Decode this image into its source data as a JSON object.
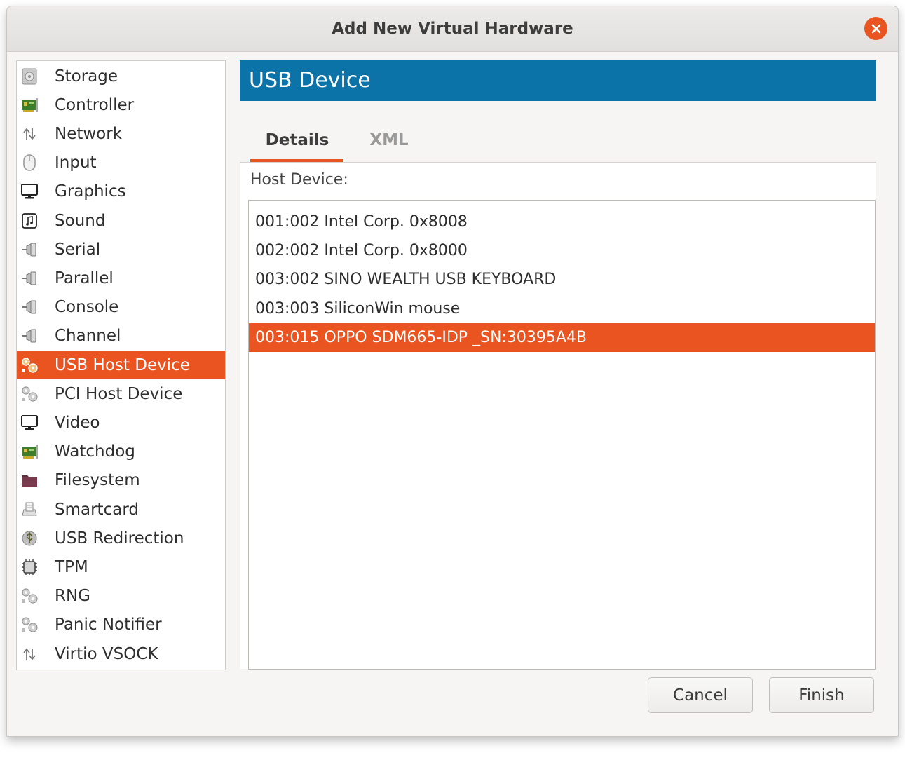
{
  "window": {
    "title": "Add New Virtual Hardware"
  },
  "sidebar": {
    "items": [
      {
        "label": "Storage",
        "icon": "storage-icon"
      },
      {
        "label": "Controller",
        "icon": "controller-icon"
      },
      {
        "label": "Network",
        "icon": "network-icon"
      },
      {
        "label": "Input",
        "icon": "input-icon"
      },
      {
        "label": "Graphics",
        "icon": "graphics-icon"
      },
      {
        "label": "Sound",
        "icon": "sound-icon"
      },
      {
        "label": "Serial",
        "icon": "serial-icon"
      },
      {
        "label": "Parallel",
        "icon": "parallel-icon"
      },
      {
        "label": "Console",
        "icon": "console-icon"
      },
      {
        "label": "Channel",
        "icon": "channel-icon"
      },
      {
        "label": "USB Host Device",
        "icon": "usb-host-device-icon",
        "selected": true
      },
      {
        "label": "PCI Host Device",
        "icon": "pci-host-device-icon"
      },
      {
        "label": "Video",
        "icon": "video-icon"
      },
      {
        "label": "Watchdog",
        "icon": "watchdog-icon"
      },
      {
        "label": "Filesystem",
        "icon": "filesystem-icon"
      },
      {
        "label": "Smartcard",
        "icon": "smartcard-icon"
      },
      {
        "label": "USB Redirection",
        "icon": "usb-redirection-icon"
      },
      {
        "label": "TPM",
        "icon": "tpm-icon"
      },
      {
        "label": "RNG",
        "icon": "rng-icon"
      },
      {
        "label": "Panic Notifier",
        "icon": "panic-notifier-icon"
      },
      {
        "label": "Virtio VSOCK",
        "icon": "virtio-vsock-icon"
      }
    ]
  },
  "main": {
    "header": "USB Device",
    "tabs": [
      {
        "label": "Details",
        "active": true
      },
      {
        "label": "XML",
        "active": false
      }
    ],
    "host_device_label": "Host Device:",
    "devices": [
      {
        "label": "001:002 Intel Corp. 0x8008",
        "selected": false
      },
      {
        "label": "002:002 Intel Corp. 0x8000",
        "selected": false
      },
      {
        "label": "003:002 SINO WEALTH USB KEYBOARD",
        "selected": false
      },
      {
        "label": "003:003 SiliconWin mouse",
        "selected": false
      },
      {
        "label": "003:015 OPPO SDM665-IDP _SN:30395A4B",
        "selected": true
      }
    ]
  },
  "buttons": {
    "cancel": "Cancel",
    "finish": "Finish"
  },
  "colors": {
    "accent": "#e95420",
    "header_blue": "#0c73a9",
    "close_button": "#e95420"
  }
}
